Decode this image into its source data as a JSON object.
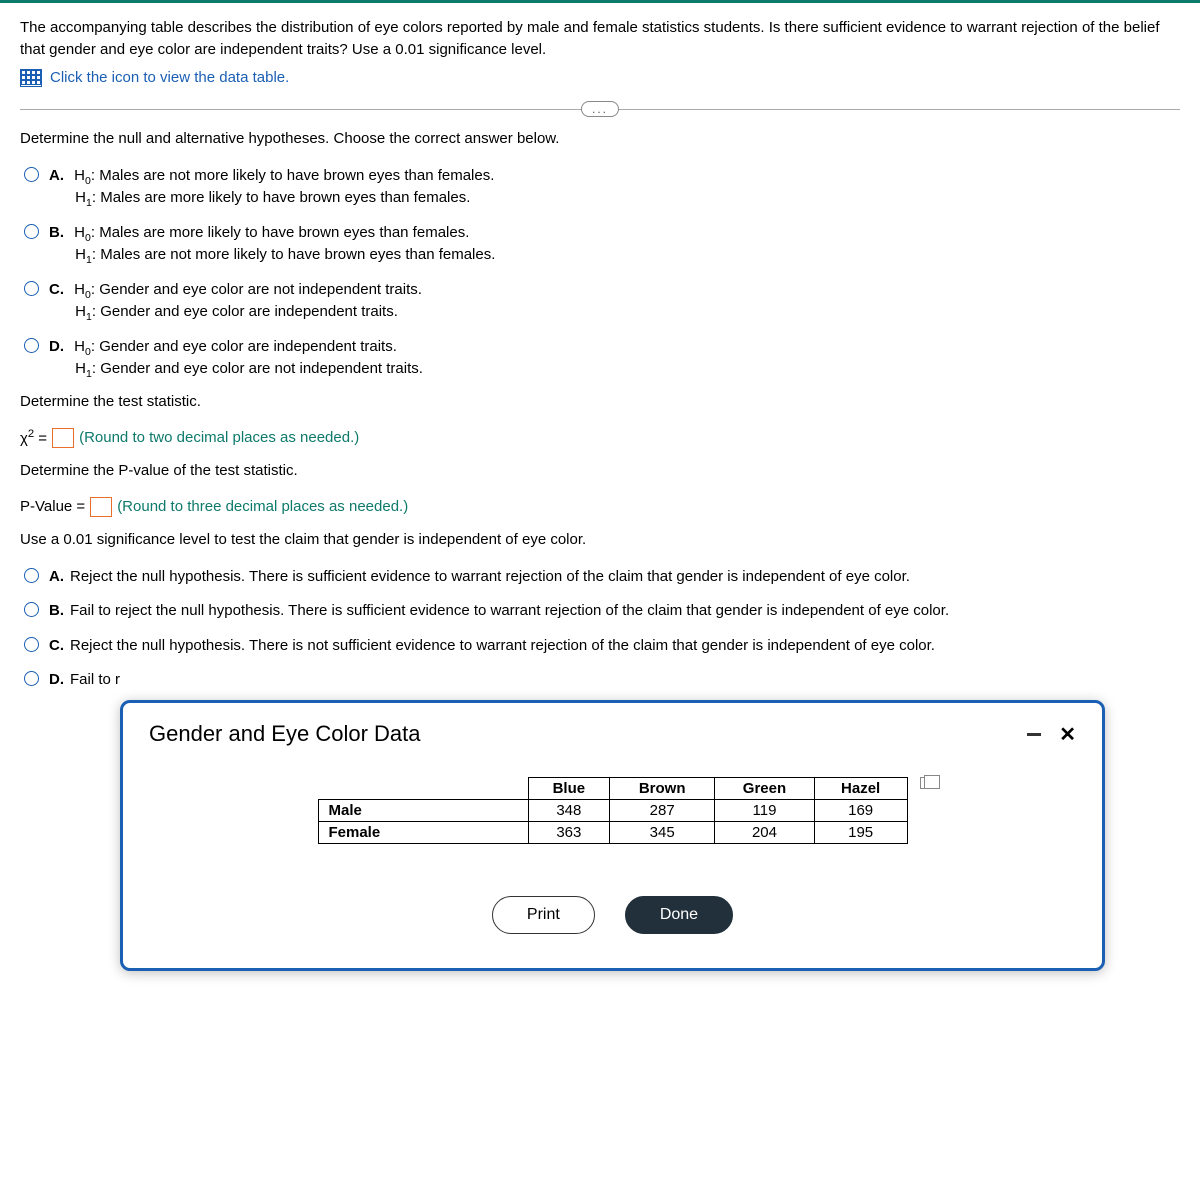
{
  "problem": {
    "text": "The accompanying table describes the distribution of eye colors reported by male and female statistics students. Is there sufficient evidence to warrant rejection of the belief that gender and eye color are independent traits? Use a 0.01 significance level.",
    "icon_label": "Click the icon to view the data table."
  },
  "ellipsis": "...",
  "q1": {
    "prompt": "Determine the null and alternative hypotheses. Choose the correct answer below.",
    "options": {
      "A": {
        "h0": "Males are not more likely to have brown eyes than females.",
        "h1": "Males are more likely to have brown eyes than females."
      },
      "B": {
        "h0": "Males are more likely to have brown eyes than females.",
        "h1": "Males are not more likely to have brown eyes than females."
      },
      "C": {
        "h0": "Gender and eye color are not independent traits.",
        "h1": "Gender and eye color are independent traits."
      },
      "D": {
        "h0": "Gender and eye color are independent traits.",
        "h1": "Gender and eye color are not independent traits."
      }
    }
  },
  "test_stat": {
    "label": "Determine the test statistic.",
    "prefix": "χ",
    "exp": "2",
    "equals": " =",
    "hint": "(Round to two decimal places as needed.)"
  },
  "pvalue": {
    "label": "Determine the P-value of the test statistic.",
    "prefix": "P-Value =",
    "hint": "(Round to three decimal places as needed.)"
  },
  "q2": {
    "prompt": "Use a 0.01 significance level to test the claim that gender is independent of eye color.",
    "options": {
      "A": "Reject the null hypothesis. There is sufficient evidence to warrant rejection of the claim that gender is independent of eye color.",
      "B": "Fail to reject the null hypothesis. There is sufficient evidence to warrant rejection of the claim that gender is independent of eye color.",
      "C": "Reject the null hypothesis. There is not sufficient evidence to warrant rejection of the claim that gender is independent of eye color.",
      "D": "Fail to r"
    }
  },
  "modal": {
    "title": "Gender and Eye Color Data",
    "headers": [
      "Blue",
      "Brown",
      "Green",
      "Hazel"
    ],
    "rows": [
      {
        "label": "Male",
        "cells": [
          "348",
          "287",
          "119",
          "169"
        ]
      },
      {
        "label": "Female",
        "cells": [
          "363",
          "345",
          "204",
          "195"
        ]
      }
    ],
    "print": "Print",
    "done": "Done"
  },
  "letters": {
    "A": "A.",
    "B": "B.",
    "C": "C.",
    "D": "D."
  },
  "hyp": {
    "h0a": "H",
    "h0b": "0",
    "h0c": ": ",
    "h1a": "H",
    "h1b": "1",
    "h1c": ": "
  },
  "chart_data": {
    "type": "table",
    "title": "Gender and Eye Color Data",
    "columns": [
      "Blue",
      "Brown",
      "Green",
      "Hazel"
    ],
    "rows": [
      "Male",
      "Female"
    ],
    "values": [
      [
        348,
        287,
        119,
        169
      ],
      [
        363,
        345,
        204,
        195
      ]
    ]
  }
}
